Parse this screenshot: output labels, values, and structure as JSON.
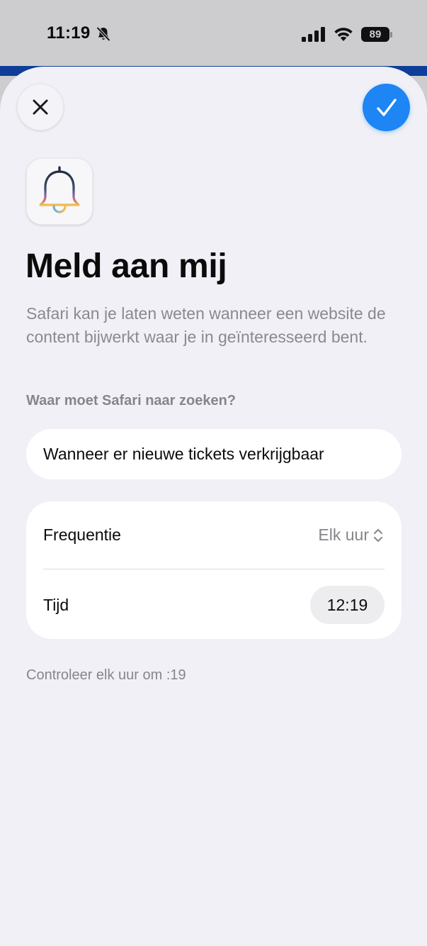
{
  "status_bar": {
    "time": "11:19",
    "battery_level": "89",
    "icons": [
      "bell-slash-icon",
      "cellular-signal-icon",
      "wifi-icon",
      "battery-icon"
    ]
  },
  "header": {
    "close_icon": "close-icon",
    "done_icon": "checkmark-icon",
    "accent_color": "#1d85f4"
  },
  "app_icon": "bell-icon",
  "title": "Meld aan mij",
  "subtitle": "Safari kan je laten weten wanneer een website de content bijwerkt waar je in geïnteresseerd bent.",
  "query": {
    "label": "Waar moet Safari naar zoeken?",
    "value": "Wanneer er nieuwe tickets verkrijgbaar"
  },
  "settings": {
    "frequency_label": "Frequentie",
    "frequency_value": "Elk uur",
    "time_label": "Tijd",
    "time_value": "12:19"
  },
  "footnote": "Controleer elk uur om :19"
}
